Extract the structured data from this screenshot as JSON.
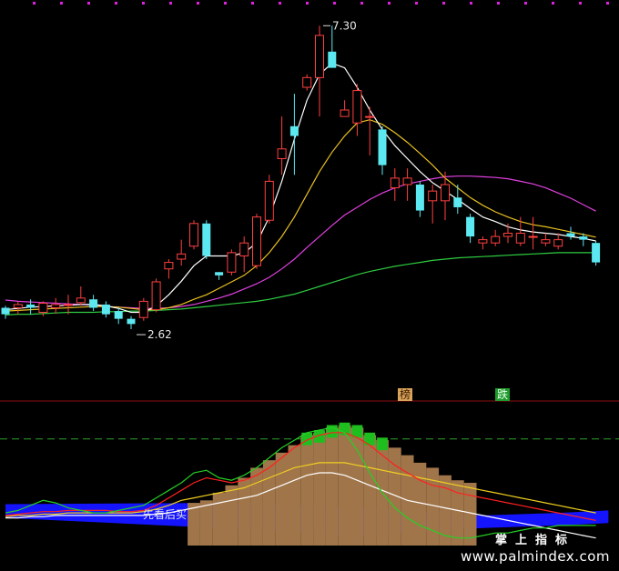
{
  "chart_data": [
    {
      "type": "candlestick",
      "ylim": [
        2.2,
        7.5
      ],
      "annotations": {
        "high": "7.30",
        "low": "2.62"
      },
      "colors": {
        "up": "#ff4040",
        "down": "#5ce8f0",
        "ma_fast": "#ffffff",
        "ma_mid": "#e8c020",
        "ma_slow": "#e040e0",
        "ma_long": "#2ecc40"
      },
      "candles": [
        [
          2.95,
          2.98,
          2.78,
          2.85
        ],
        [
          2.95,
          3.05,
          2.85,
          3.0
        ],
        [
          3.0,
          3.08,
          2.85,
          2.95
        ],
        [
          2.88,
          3.05,
          2.82,
          3.02
        ],
        [
          2.95,
          3.1,
          2.86,
          3.0
        ],
        [
          2.99,
          3.15,
          2.85,
          3.0
        ],
        [
          3.03,
          3.28,
          2.98,
          3.1
        ],
        [
          3.08,
          3.15,
          2.9,
          2.95
        ],
        [
          3.0,
          3.05,
          2.8,
          2.85
        ],
        [
          2.9,
          2.95,
          2.7,
          2.78
        ],
        [
          2.78,
          2.82,
          2.62,
          2.7
        ],
        [
          2.8,
          3.1,
          2.75,
          3.05
        ],
        [
          2.92,
          3.4,
          2.88,
          3.35
        ],
        [
          3.55,
          3.7,
          3.4,
          3.65
        ],
        [
          3.7,
          4.0,
          3.6,
          3.78
        ],
        [
          3.9,
          4.3,
          3.85,
          4.25
        ],
        [
          4.25,
          4.3,
          3.7,
          3.75
        ],
        [
          3.5,
          3.5,
          3.38,
          3.45
        ],
        [
          3.5,
          3.85,
          3.45,
          3.8
        ],
        [
          3.75,
          4.05,
          3.5,
          3.95
        ],
        [
          3.6,
          4.4,
          3.55,
          4.35
        ],
        [
          4.3,
          5.0,
          4.25,
          4.9
        ],
        [
          5.25,
          5.9,
          5.0,
          5.4
        ],
        [
          5.75,
          6.25,
          5.0,
          5.6
        ],
        [
          6.35,
          6.55,
          6.3,
          6.5
        ],
        [
          6.5,
          7.3,
          5.9,
          7.15
        ],
        [
          6.9,
          7.3,
          6.7,
          6.65
        ],
        [
          5.9,
          6.15,
          5.9,
          6.0
        ],
        [
          5.8,
          6.4,
          5.6,
          6.3
        ],
        [
          5.9,
          6.05,
          5.3,
          5.9
        ],
        [
          5.7,
          5.75,
          5.0,
          5.15
        ],
        [
          4.8,
          5.1,
          4.6,
          4.95
        ],
        [
          4.85,
          5.1,
          4.6,
          4.95
        ],
        [
          4.85,
          4.9,
          4.35,
          4.45
        ],
        [
          4.6,
          4.85,
          4.25,
          4.75
        ],
        [
          4.6,
          5.05,
          4.3,
          4.85
        ],
        [
          4.65,
          4.85,
          4.4,
          4.5
        ],
        [
          4.35,
          4.4,
          3.95,
          4.05
        ],
        [
          3.95,
          4.05,
          3.85,
          4.0
        ],
        [
          3.95,
          4.15,
          3.9,
          4.05
        ],
        [
          4.05,
          4.25,
          3.95,
          4.1
        ],
        [
          3.95,
          4.35,
          3.9,
          4.1
        ],
        [
          4.05,
          4.35,
          3.85,
          4.05
        ],
        [
          3.95,
          4.1,
          3.9,
          4.0
        ],
        [
          3.9,
          4.1,
          3.85,
          4.0
        ],
        [
          4.1,
          4.2,
          4.0,
          4.05
        ],
        [
          4.05,
          4.1,
          3.9,
          4.0
        ],
        [
          3.95,
          3.98,
          3.6,
          3.65
        ]
      ],
      "ma_fast": [
        2.92,
        2.94,
        2.96,
        2.97,
        2.98,
        2.99,
        3.0,
        3.0,
        2.98,
        2.94,
        2.88,
        2.88,
        2.98,
        3.15,
        3.36,
        3.6,
        3.75,
        3.75,
        3.75,
        3.8,
        3.95,
        4.35,
        4.9,
        5.55,
        6.15,
        6.55,
        6.72,
        6.65,
        6.35,
        6.0,
        5.7,
        5.45,
        5.25,
        5.05,
        4.88,
        4.75,
        4.62,
        4.48,
        4.35,
        4.28,
        4.2,
        4.15,
        4.12,
        4.1,
        4.08,
        4.05,
        4.02,
        3.98
      ],
      "ma_mid": [
        2.9,
        2.91,
        2.92,
        2.93,
        2.94,
        2.95,
        2.96,
        2.97,
        2.97,
        2.96,
        2.94,
        2.92,
        2.92,
        2.95,
        3.0,
        3.08,
        3.15,
        3.25,
        3.35,
        3.45,
        3.6,
        3.8,
        4.05,
        4.35,
        4.7,
        5.05,
        5.35,
        5.6,
        5.8,
        5.85,
        5.78,
        5.65,
        5.5,
        5.33,
        5.15,
        4.95,
        4.8,
        4.65,
        4.53,
        4.43,
        4.35,
        4.28,
        4.23,
        4.2,
        4.16,
        4.12,
        4.08,
        4.04
      ],
      "ma_slow": [
        3.07,
        3.05,
        3.04,
        3.03,
        3.02,
        3.01,
        3.0,
        2.99,
        2.97,
        2.96,
        2.95,
        2.94,
        2.94,
        2.95,
        2.97,
        3.0,
        3.05,
        3.1,
        3.16,
        3.24,
        3.32,
        3.42,
        3.55,
        3.7,
        3.88,
        4.05,
        4.22,
        4.38,
        4.5,
        4.62,
        4.72,
        4.8,
        4.86,
        4.9,
        4.94,
        4.97,
        4.98,
        4.98,
        4.97,
        4.96,
        4.94,
        4.9,
        4.86,
        4.8,
        4.72,
        4.64,
        4.54,
        4.44
      ],
      "ma_long": [
        2.84,
        2.85,
        2.85,
        2.86,
        2.87,
        2.88,
        2.88,
        2.88,
        2.89,
        2.89,
        2.9,
        2.9,
        2.91,
        2.92,
        2.93,
        2.95,
        2.97,
        2.99,
        3.01,
        3.03,
        3.05,
        3.08,
        3.12,
        3.16,
        3.22,
        3.28,
        3.34,
        3.4,
        3.46,
        3.51,
        3.55,
        3.59,
        3.62,
        3.65,
        3.68,
        3.7,
        3.72,
        3.73,
        3.74,
        3.75,
        3.76,
        3.77,
        3.78,
        3.79,
        3.8,
        3.8,
        3.8,
        3.8
      ]
    },
    {
      "type": "indicator",
      "ylim": [
        0,
        100
      ],
      "dashed_level": 85,
      "tags": {
        "bang": "榜",
        "die": "跌"
      },
      "signal_label": "先看后买",
      "colors": {
        "blue_band": "#1414ff",
        "bars": "#a0754a",
        "green_bars": "#1fbe1f",
        "red": "#ff2020",
        "yellow": "#f0d020",
        "green": "#24d024",
        "white": "#ffffff",
        "magenta": "#d040d0"
      },
      "blue_band": [
        [
          0,
          22,
          33
        ],
        [
          17,
          14,
          34
        ],
        [
          29,
          7,
          30
        ],
        [
          30,
          9,
          28
        ],
        [
          38,
          14,
          24
        ],
        [
          44,
          16,
          26
        ],
        [
          48,
          18,
          28
        ]
      ],
      "bars": [
        2,
        2,
        2,
        2,
        2,
        2,
        2,
        2,
        2,
        2,
        2,
        2,
        2,
        2,
        2,
        34,
        36,
        42,
        48,
        54,
        62,
        68,
        74,
        80,
        88,
        90,
        94,
        96,
        94,
        88,
        84,
        78,
        72,
        66,
        62,
        56,
        52,
        50,
        2,
        2,
        2,
        2,
        2,
        2,
        2,
        2,
        2,
        2
      ],
      "green_bars": [
        0,
        0,
        0,
        0,
        0,
        0,
        0,
        0,
        0,
        0,
        0,
        0,
        0,
        0,
        0,
        0,
        0,
        0,
        0,
        0,
        0,
        0,
        0,
        0,
        0,
        0,
        0,
        0,
        0,
        0,
        0,
        0,
        0,
        0,
        0,
        0,
        0,
        0,
        0,
        0,
        0,
        0,
        0,
        0,
        0,
        0,
        0,
        0
      ],
      "line_red": [
        24,
        25,
        26,
        27,
        27,
        28,
        28,
        28,
        28,
        27,
        27,
        28,
        32,
        38,
        44,
        50,
        54,
        52,
        50,
        52,
        56,
        62,
        70,
        78,
        84,
        88,
        90,
        90,
        86,
        80,
        72,
        64,
        58,
        52,
        48,
        46,
        42,
        40,
        38,
        36,
        34,
        32,
        30,
        28,
        26,
        24,
        22,
        20
      ],
      "line_yellow": [
        23,
        24,
        24,
        25,
        25,
        26,
        26,
        26,
        26,
        26,
        26,
        27,
        29,
        32,
        36,
        38,
        40,
        42,
        44,
        46,
        50,
        54,
        58,
        62,
        64,
        66,
        66,
        66,
        64,
        62,
        60,
        58,
        56,
        54,
        52,
        50,
        48,
        46,
        44,
        42,
        40,
        38,
        36,
        34,
        32,
        30,
        28,
        26
      ],
      "line_green": [
        26,
        28,
        32,
        36,
        34,
        30,
        28,
        26,
        26,
        28,
        30,
        32,
        38,
        44,
        50,
        58,
        60,
        54,
        52,
        56,
        62,
        70,
        78,
        84,
        90,
        92,
        94,
        90,
        76,
        58,
        42,
        30,
        22,
        16,
        12,
        8,
        6,
        6,
        8,
        10,
        10,
        12,
        14,
        14,
        16,
        16,
        16,
        16
      ],
      "line_white": [
        22,
        22,
        23,
        23,
        24,
        24,
        24,
        24,
        24,
        24,
        24,
        24,
        25,
        26,
        28,
        30,
        32,
        34,
        36,
        38,
        40,
        44,
        48,
        52,
        56,
        58,
        58,
        56,
        52,
        48,
        44,
        40,
        36,
        34,
        32,
        30,
        28,
        26,
        24,
        22,
        20,
        18,
        16,
        14,
        12,
        10,
        8,
        6
      ]
    }
  ],
  "watermark": {
    "line1": "掌上指标",
    "line2": "www.palmindex.com"
  }
}
